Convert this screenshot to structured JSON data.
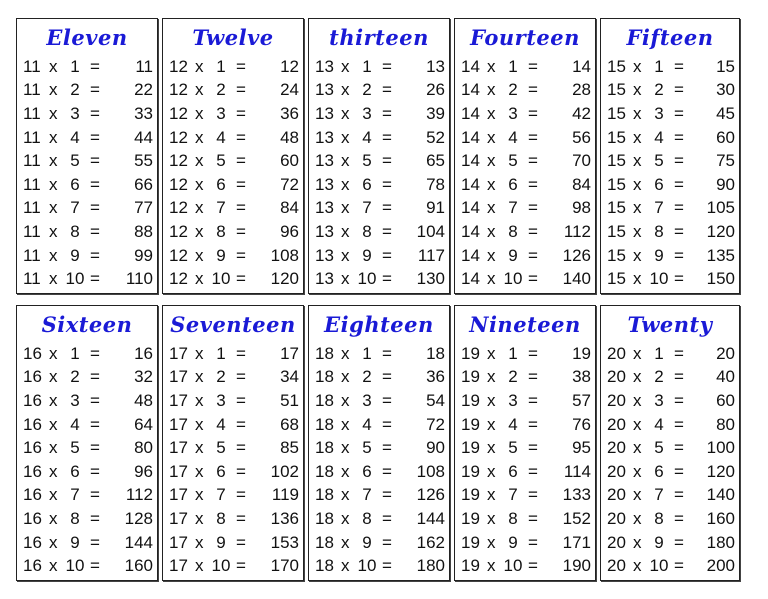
{
  "tables": [
    {
      "title": "Eleven",
      "n": 11
    },
    {
      "title": "Twelve",
      "n": 12
    },
    {
      "title": "thirteen",
      "n": 13
    },
    {
      "title": "Fourteen",
      "n": 14
    },
    {
      "title": "Fifteen",
      "n": 15
    },
    {
      "title": "Sixteen",
      "n": 16
    },
    {
      "title": "Seventeen",
      "n": 17
    },
    {
      "title": "Eighteen",
      "n": 18
    },
    {
      "title": "Nineteen",
      "n": 19
    },
    {
      "title": "Twenty",
      "n": 20
    }
  ],
  "operator": "x",
  "equals": "=",
  "multipliers": [
    1,
    2,
    3,
    4,
    5,
    6,
    7,
    8,
    9,
    10
  ],
  "colors": {
    "title": "#1a1ad6",
    "text": "#111111",
    "border": "#222222"
  }
}
